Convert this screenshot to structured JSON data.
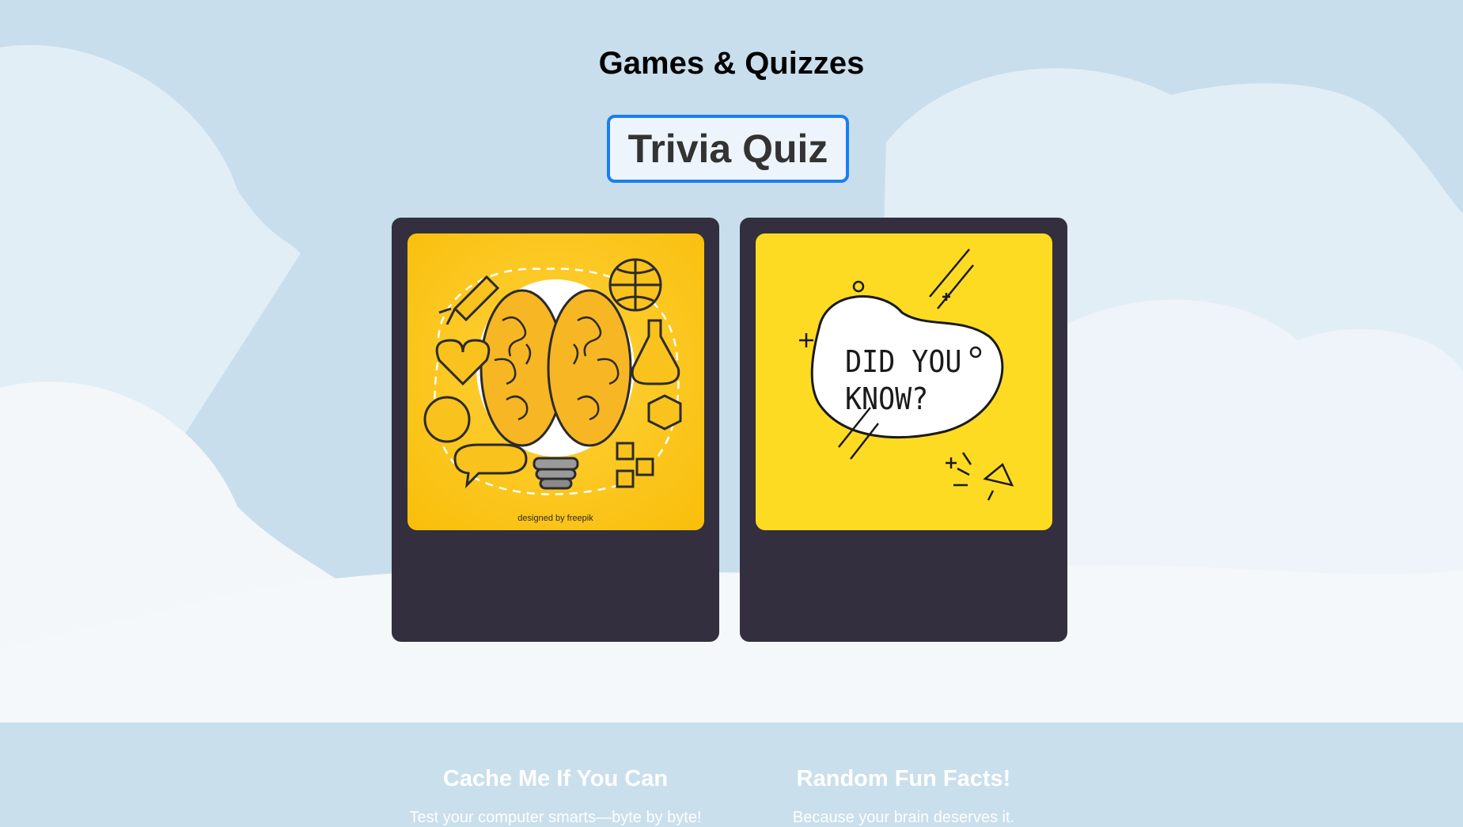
{
  "page": {
    "title": "Games & Quizzes"
  },
  "tabs": {
    "active_label": "Trivia Quiz"
  },
  "cards": [
    {
      "title": "Cache Me If You Can",
      "description": "Test your computer smarts—byte by byte!",
      "image_credit": "designed by freepik",
      "image_subject": "brain-lightbulb-doodle"
    },
    {
      "title": "Random Fun Facts!",
      "description": "Because your brain deserves it.",
      "image_text_line1": "DID YOU",
      "image_text_line2": "KNOW?",
      "image_subject": "did-you-know-speech-blob"
    }
  ],
  "colors": {
    "background": "#c9dfec",
    "cloud": "#eef4f9",
    "card": "#332f3e",
    "accent_border": "#1a7ef0",
    "thumb_yellow_1": "#fbc40f",
    "thumb_yellow_2": "#fedb23"
  }
}
